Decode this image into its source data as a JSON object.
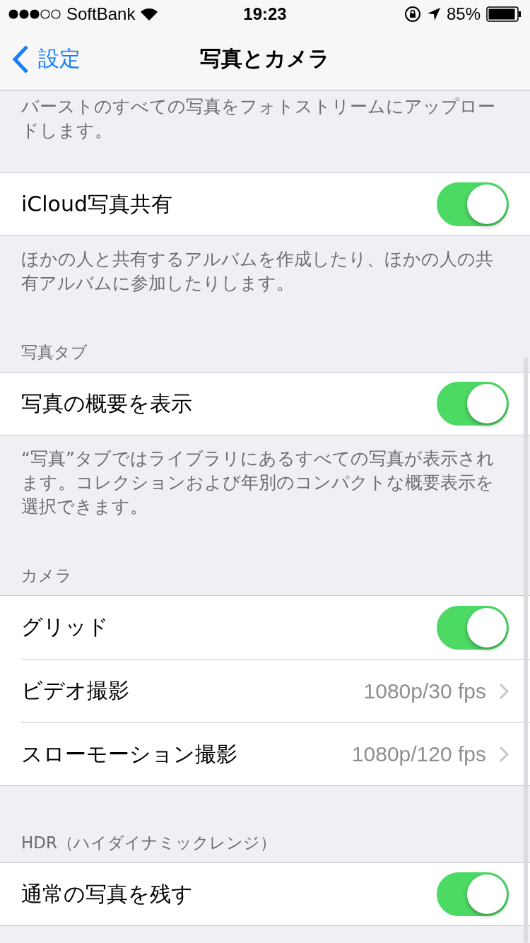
{
  "status_bar": {
    "carrier": "SoftBank",
    "time": "19:23",
    "battery": "85%"
  },
  "nav": {
    "back": "設定",
    "title": "写真とカメラ"
  },
  "sections": [
    {
      "footer": "バーストのすべての写真をフォトストリームにアップロードします。"
    },
    {
      "rows": [
        {
          "kind": "toggle",
          "label": "iCloud写真共有",
          "on": true
        }
      ],
      "footer": "ほかの人と共有するアルバムを作成したり、ほかの人の共有アルバムに参加したりします。"
    },
    {
      "header": "写真タブ",
      "rows": [
        {
          "kind": "toggle",
          "label": "写真の概要を表示",
          "on": true
        }
      ],
      "footer": "“写真”タブではライブラリにあるすべての写真が表示されます。コレクションおよび年別のコンパクトな概要表示を選択できます。"
    },
    {
      "header": "カメラ",
      "rows": [
        {
          "kind": "toggle",
          "label": "グリッド",
          "on": true
        },
        {
          "kind": "value",
          "label": "ビデオ撮影",
          "value": "1080p/30 fps"
        },
        {
          "kind": "value",
          "label": "スローモーション撮影",
          "value": "1080p/120 fps"
        }
      ]
    },
    {
      "header": "HDR（ハイダイナミックレンジ）",
      "rows": [
        {
          "kind": "toggle",
          "label": "通常の写真を残す",
          "on": true
        }
      ]
    }
  ]
}
